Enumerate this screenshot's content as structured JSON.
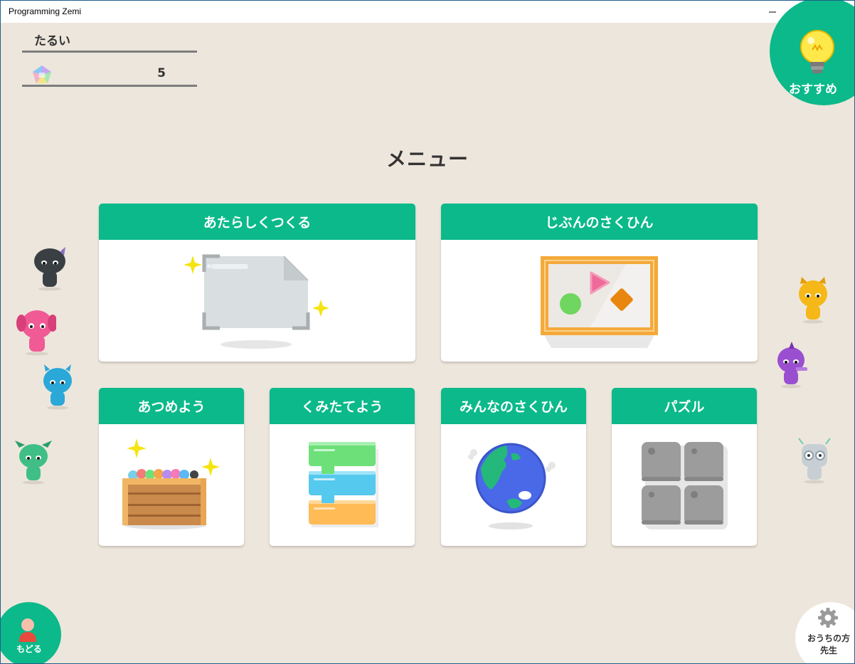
{
  "window": {
    "title": "Programming Zemi"
  },
  "user": {
    "name": "たるい",
    "gem_count": "5"
  },
  "recommend": {
    "label": "おすすめ"
  },
  "page": {
    "title": "メニュー"
  },
  "cards": {
    "new_create": "あたらしくつくる",
    "my_works": "じぶんのさくひん",
    "collect": "あつめよう",
    "assemble": "くみたてよう",
    "everyone_works": "みんなのさくひん",
    "puzzle": "パズル"
  },
  "footer": {
    "back_label": "もどる",
    "parent_label_line1": "おうちの方",
    "parent_label_line2": "先生"
  },
  "colors": {
    "accent": "#0bb98a",
    "background": "#ede6dc"
  }
}
